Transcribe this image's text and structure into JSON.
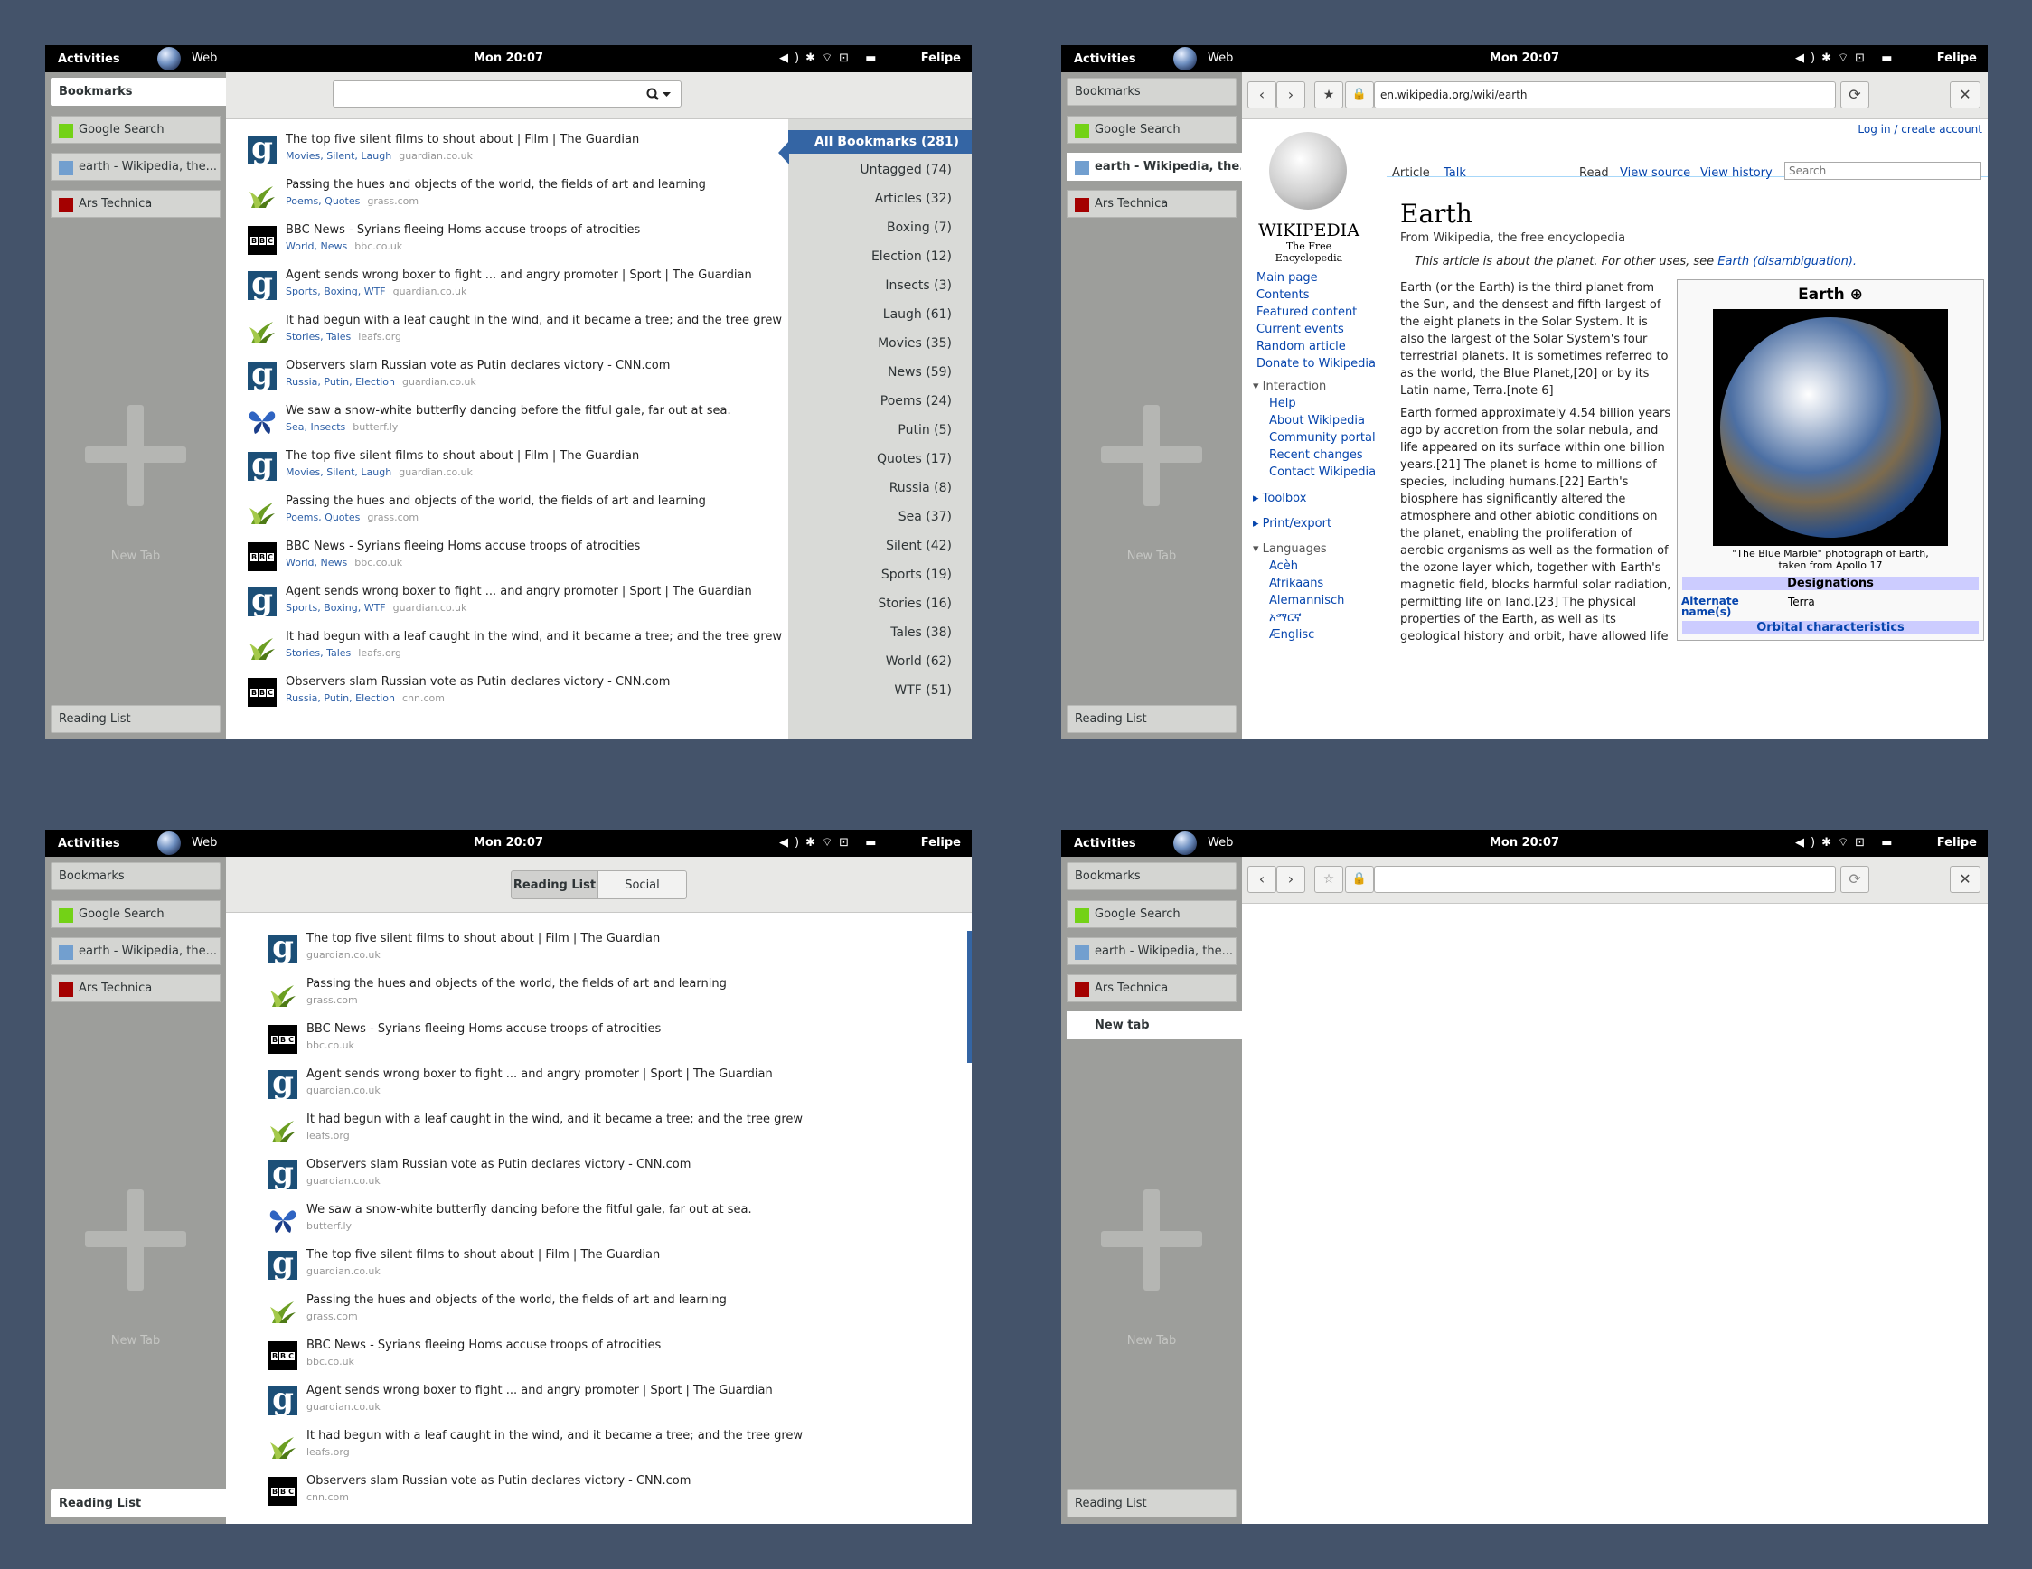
{
  "topbar": {
    "activities": "Activities",
    "app": "Web",
    "clock": "Mon 20:07",
    "user": "Felipe",
    "sys_icons": [
      "volume-icon",
      "bluetooth-icon",
      "wifi-icon",
      "lock-icon",
      "chat-icon"
    ]
  },
  "sidebar": {
    "bookmarks": "Bookmarks",
    "reading_list": "Reading List",
    "new_tab": "New Tab",
    "tabs": [
      {
        "label": "Google Search",
        "color": "#73d216"
      },
      {
        "label": "earth - Wikipedia, the...",
        "color": "#729fcf"
      },
      {
        "label": "Ars Technica",
        "color": "#a40000"
      }
    ],
    "new_tab_entry": "New tab"
  },
  "items": [
    {
      "title": "The top five silent films to shout about | Film | The Guardian",
      "tags": "Movies, Silent, Laugh",
      "domain": "guardian.co.uk",
      "icon": "guardian"
    },
    {
      "title": "Passing the hues and objects of the world, the fields of art and learning",
      "tags": "Poems, Quotes",
      "domain": "grass.com",
      "icon": "grass"
    },
    {
      "title": "BBC News - Syrians fleeing Homs accuse troops of atrocities",
      "tags": "World, News",
      "domain": "bbc.co.uk",
      "icon": "bbc"
    },
    {
      "title": "Agent sends wrong boxer to fight ... and angry promoter | Sport | The Guardian",
      "tags": "Sports, Boxing, WTF",
      "domain": "guardian.co.uk",
      "icon": "guardian"
    },
    {
      "title": "It had begun with a leaf caught in the wind, and it became a tree; and the tree grew",
      "tags": "Stories, Tales",
      "domain": "leafs.org",
      "icon": "grass"
    },
    {
      "title": "Observers slam Russian vote as Putin declares victory - CNN.com",
      "tags": "Russia, Putin, Election",
      "domain": "guardian.co.uk",
      "icon": "guardian"
    },
    {
      "title": "We saw a snow-white butterfly dancing before the fitful gale, far out at sea.",
      "tags": "Sea, Insects",
      "domain": "butterf.ly",
      "icon": "butterfly"
    },
    {
      "title": "The top five silent films to shout about | Film | The Guardian",
      "tags": "Movies, Silent, Laugh",
      "domain": "guardian.co.uk",
      "icon": "guardian"
    },
    {
      "title": "Passing the hues and objects of the world, the fields of art and learning",
      "tags": "Poems, Quotes",
      "domain": "grass.com",
      "icon": "grass"
    },
    {
      "title": "BBC News - Syrians fleeing Homs accuse troops of atrocities",
      "tags": "World, News",
      "domain": "bbc.co.uk",
      "icon": "bbc"
    },
    {
      "title": "Agent sends wrong boxer to fight ... and angry promoter | Sport | The Guardian",
      "tags": "Sports, Boxing, WTF",
      "domain": "guardian.co.uk",
      "icon": "guardian"
    },
    {
      "title": "It had begun with a leaf caught in the wind, and it became a tree; and the tree grew",
      "tags": "Stories, Tales",
      "domain": "leafs.org",
      "icon": "grass"
    },
    {
      "title": "Observers slam Russian vote as Putin declares victory - CNN.com",
      "tags": "Russia, Putin, Election",
      "domain": "cnn.com",
      "icon": "bbc"
    }
  ],
  "reading_domains": [
    "guardian.co.uk",
    "grass.com",
    "bbc.co.uk",
    "guardian.co.uk",
    "leafs.org",
    "guardian.co.uk",
    "butterf.ly",
    "guardian.co.uk",
    "grass.com",
    "bbc.co.uk",
    "guardian.co.uk",
    "leafs.org",
    "cnn.com"
  ],
  "tags": {
    "selected": "All Bookmarks (281)",
    "list": [
      "Untagged (74)",
      "Articles (32)",
      "Boxing (7)",
      "Election (12)",
      "Insects (3)",
      "Laugh (61)",
      "Movies (35)",
      "News (59)",
      "Poems (24)",
      "Putin (5)",
      "Quotes (17)",
      "Russia (8)",
      "Sea (37)",
      "Silent (42)",
      "Sports (19)",
      "Stories (16)",
      "Tales (38)",
      "World (62)",
      "WTF (51)"
    ]
  },
  "reading": {
    "tab_reading": "Reading List",
    "tab_social": "Social"
  },
  "wiki": {
    "url": "en.wikipedia.org/wiki/earth",
    "login": "Log in / create account",
    "logo_title": "WIKIPEDIA",
    "logo_sub": "The Free Encyclopedia",
    "tabs": {
      "article": "Article",
      "talk": "Talk",
      "read": "Read",
      "view_source": "View source",
      "view_history": "View history"
    },
    "search_placeholder": "Search",
    "title": "Earth",
    "from": "From Wikipedia, the free encyclopedia",
    "hatnote": "This article is about the planet. For other uses, see",
    "hatnote_link": "Earth (disambiguation).",
    "nav": [
      "Main page",
      "Contents",
      "Featured content",
      "Current events",
      "Random article",
      "Donate to Wikipedia"
    ],
    "interaction_head": "Interaction",
    "interaction": [
      "Help",
      "About Wikipedia",
      "Community portal",
      "Recent changes",
      "Contact Wikipedia"
    ],
    "toolbox": "Toolbox",
    "print": "Print/export",
    "languages_head": "Languages",
    "languages": [
      "Acèh",
      "Afrikaans",
      "Alemannisch",
      "አማርኛ",
      "Ænglisc"
    ],
    "para1": "Earth (or the Earth) is the third planet from the Sun, and the densest and fifth-largest of the eight planets in the Solar System. It is also the largest of the Solar System's four terrestrial planets. It is sometimes referred to as the world, the Blue Planet,[20] or by its Latin name, Terra.[note 6]",
    "para2": "Earth formed approximately 4.54 billion years ago by accretion from the solar nebula, and life appeared on its surface within one billion years.[21] The planet is home to millions of species, including humans.[22] Earth's biosphere has significantly altered the atmosphere and other abiotic conditions on the planet, enabling the proliferation of aerobic organisms as well as the formation of the ozone layer which, together with Earth's magnetic field, blocks harmful solar radiation, permitting life on land.[23] The physical properties of the Earth, as well as its geological history and orbit, have allowed life",
    "infobox_title": "Earth",
    "caption1": "\"The Blue Marble\" photograph of Earth,",
    "caption2": "taken from Apollo 17",
    "designations": "Designations",
    "alt_name_label": "Alternate name(s)",
    "alt_name_value": "Terra",
    "orbital": "Orbital characteristics"
  }
}
